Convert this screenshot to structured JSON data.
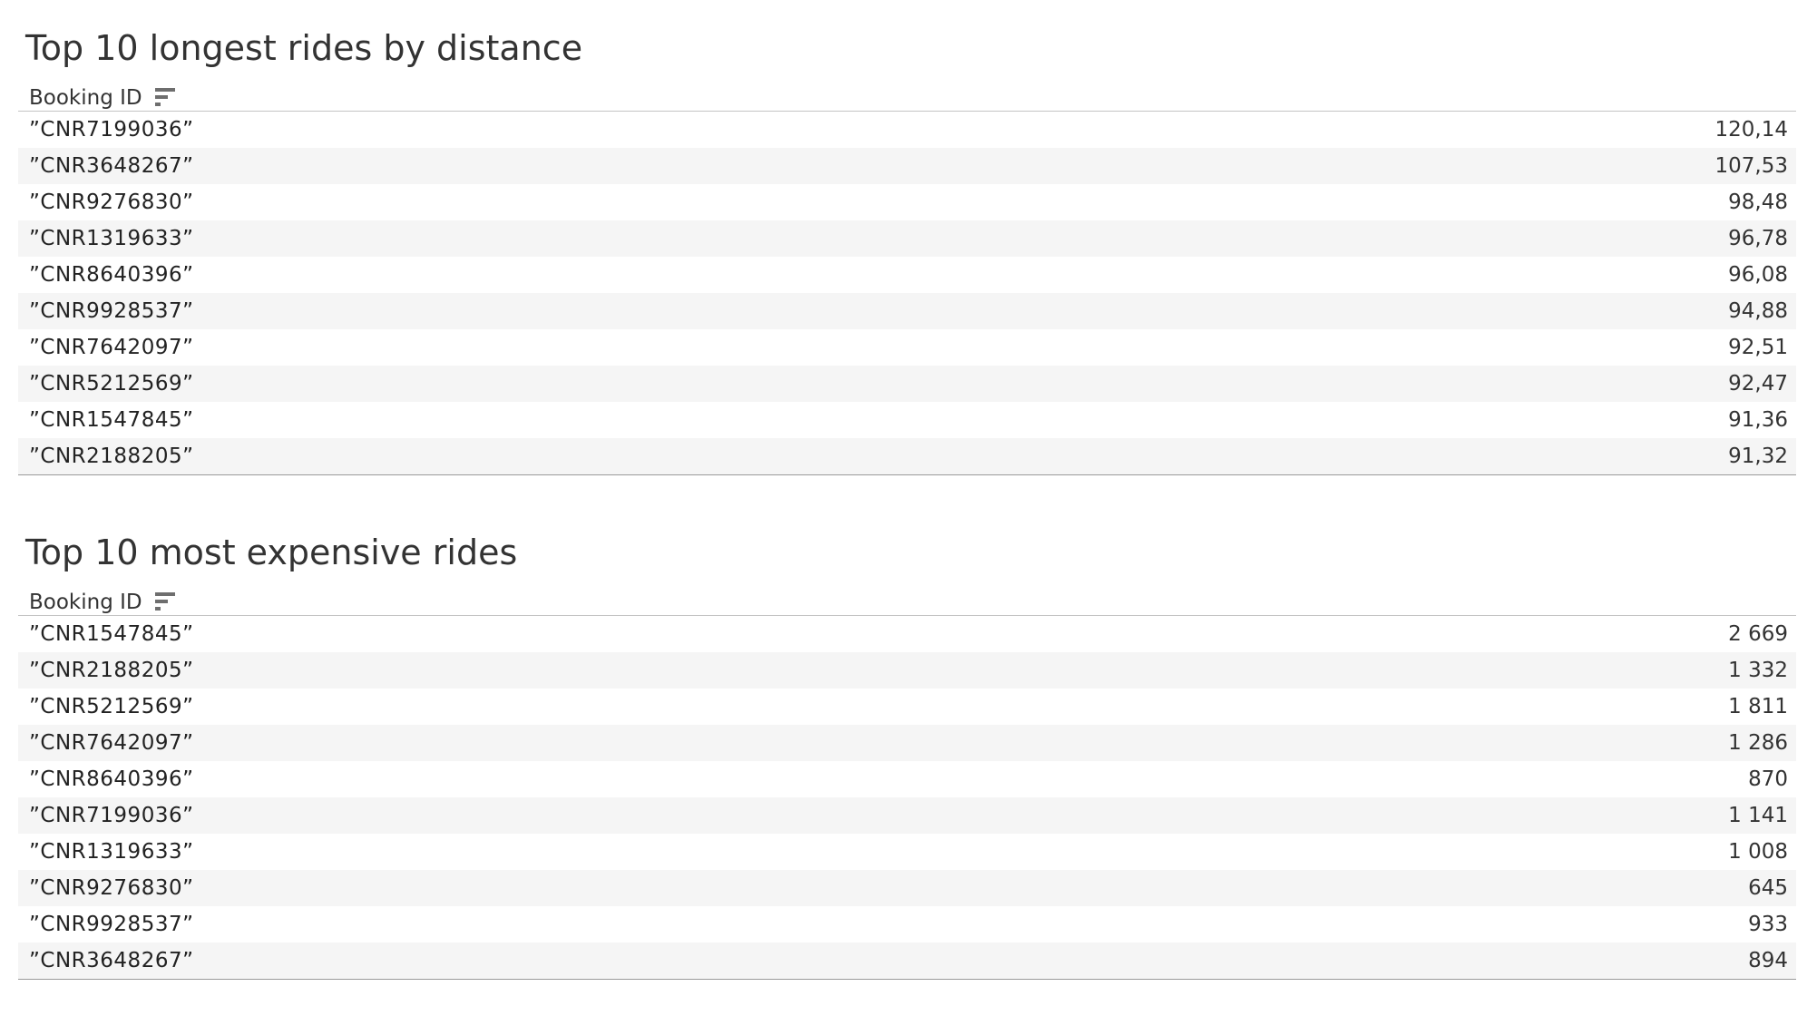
{
  "distance_table": {
    "title": "Top 10 longest rides by distance",
    "column_header": "Booking ID",
    "sort_icon": "sort-descending-icon",
    "rows": [
      {
        "booking_id": "”CNR7199036”",
        "value": "120,14"
      },
      {
        "booking_id": "”CNR3648267”",
        "value": "107,53"
      },
      {
        "booking_id": "”CNR9276830”",
        "value": "98,48"
      },
      {
        "booking_id": "”CNR1319633”",
        "value": "96,78"
      },
      {
        "booking_id": "”CNR8640396”",
        "value": "96,08"
      },
      {
        "booking_id": "”CNR9928537”",
        "value": "94,88"
      },
      {
        "booking_id": "”CNR7642097”",
        "value": "92,51"
      },
      {
        "booking_id": "”CNR5212569”",
        "value": "92,47"
      },
      {
        "booking_id": "”CNR1547845”",
        "value": "91,36"
      },
      {
        "booking_id": "”CNR2188205”",
        "value": "91,32"
      }
    ]
  },
  "fare_table": {
    "title": "Top 10 most expensive rides",
    "column_header": "Booking ID",
    "sort_icon": "sort-descending-icon",
    "rows": [
      {
        "booking_id": "”CNR1547845”",
        "value": "2 669"
      },
      {
        "booking_id": "”CNR2188205”",
        "value": "1 332"
      },
      {
        "booking_id": "”CNR5212569”",
        "value": "1 811"
      },
      {
        "booking_id": "”CNR7642097”",
        "value": "1 286"
      },
      {
        "booking_id": "”CNR8640396”",
        "value": "870"
      },
      {
        "booking_id": "”CNR7199036”",
        "value": "1 141"
      },
      {
        "booking_id": "”CNR1319633”",
        "value": "1 008"
      },
      {
        "booking_id": "”CNR9276830”",
        "value": "645"
      },
      {
        "booking_id": "”CNR9928537”",
        "value": "933"
      },
      {
        "booking_id": "”CNR3648267”",
        "value": "894"
      }
    ]
  },
  "colors": {
    "text": "#333333",
    "row_band": "#f5f5f5",
    "divider": "#c4c4c4",
    "sort_icon": "#6e6e6e"
  }
}
